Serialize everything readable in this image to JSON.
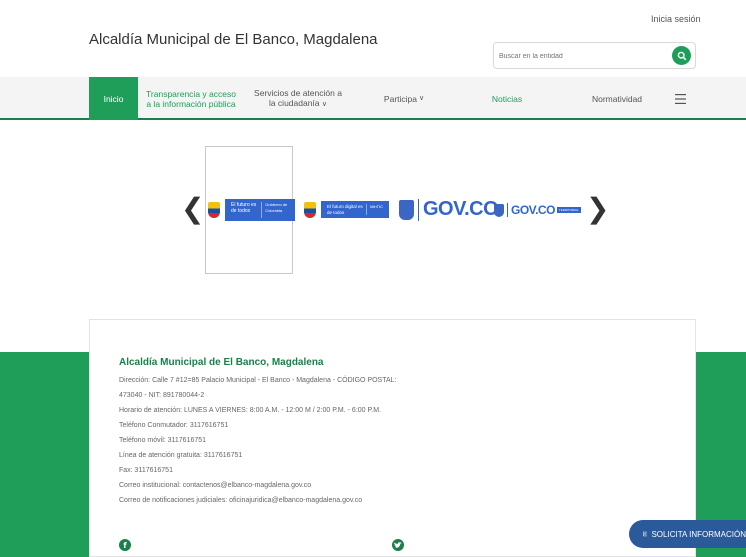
{
  "header": {
    "login_label": "Inicia sesión",
    "site_title": "Alcaldía Municipal de El Banco, Magdalena",
    "search_placeholder": "Buscar en la entidad"
  },
  "nav": {
    "items": [
      {
        "label": "Inicio"
      },
      {
        "label": "Transparencia y acceso a la información pública"
      },
      {
        "label": "Servicios de atención a la ciudadanía"
      },
      {
        "label": "Participa"
      },
      {
        "label": "Noticias"
      },
      {
        "label": "Normatividad"
      }
    ],
    "menu_icon": "hamburger-icon"
  },
  "carousel": {
    "prev_icon": "chevron-left-icon",
    "next_icon": "chevron-right-icon",
    "logo1_a": "El futuro es de todos",
    "logo1_b": "Gobierno de Colombia",
    "logo2_a": "El futuro digital es de todos",
    "logo2_b": "MinTIC",
    "gov_large": "GOV.CO",
    "gov_small": "GOV.CO",
    "gov_small_tag": "TERRITORIAL"
  },
  "footer": {
    "title": "Alcaldía Municipal de El Banco, Magdalena",
    "lines": [
      "Dirección: Calle 7 #12=85 Palacio Municipal - El Banco - Magdalena - CÓDIGO POSTAL:",
      "473040 - NIT: 891780044-2",
      "Horario de atención: LUNES A VIERNES: 8:00 A.M. - 12:00 M / 2:00 P.M. - 6:00 P.M.",
      "Teléfono Conmutador: 3117616751",
      "Teléfono móvil: 3117616751",
      "Línea de atención gratuita: 3117616751",
      "Fax: 3117616751",
      "Correo institucional: contactenos@elbanco-magdalena.gov.co",
      "Correo de notificaciones judiciales: oficinajuridica@elbanco-magdalena.gov.co"
    ],
    "social_icons": [
      "facebook-icon",
      "twitter-icon"
    ]
  },
  "request_button": {
    "label": "SOLICITA INFORMACIÓN"
  },
  "colors": {
    "primary_green": "#1f9e5a",
    "dark_green": "#1a7f4a",
    "gov_blue": "#3366cc",
    "request_blue": "#2a5a9a"
  }
}
